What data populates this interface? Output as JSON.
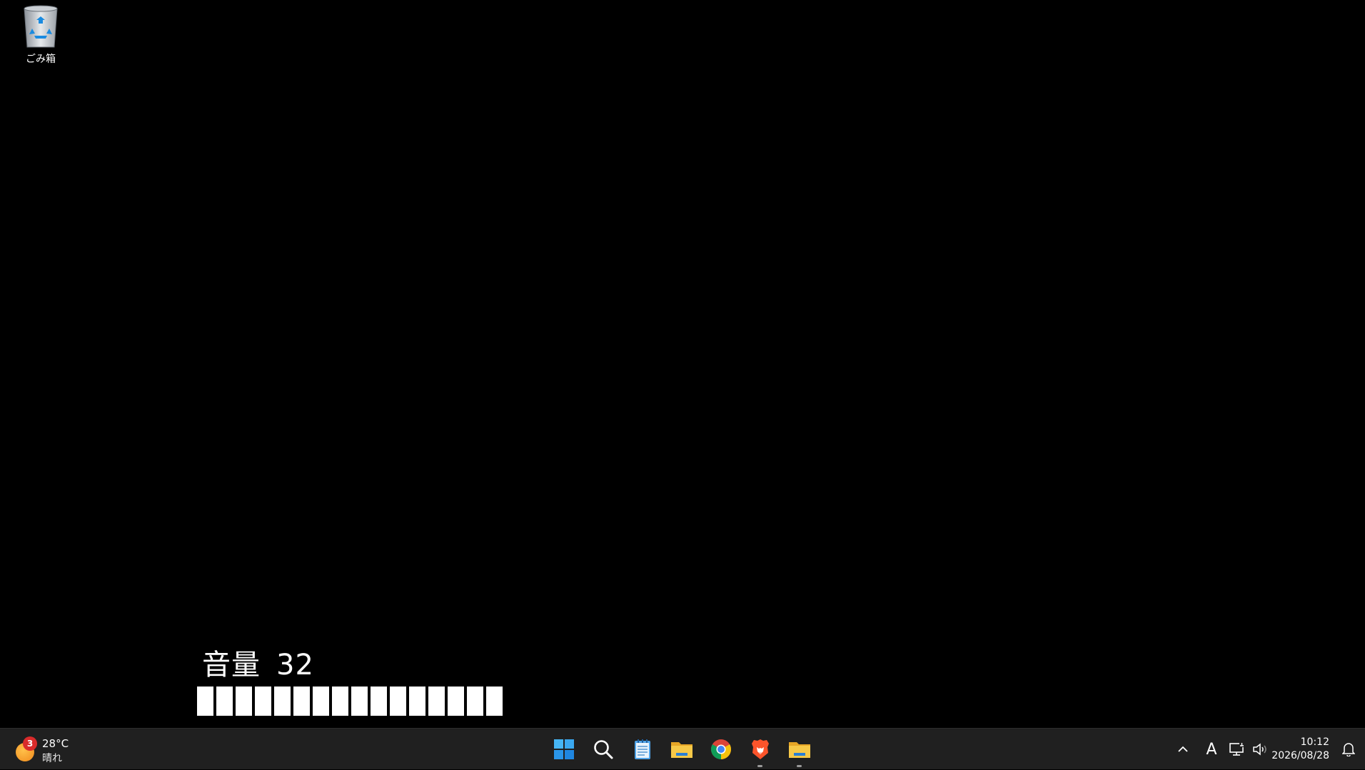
{
  "desktop": {
    "icons": [
      {
        "label": "ごみ箱",
        "icon": "recycle-bin-icon"
      }
    ]
  },
  "volume_osd": {
    "label": "音量",
    "value": "32",
    "level_percent": 32,
    "segments_filled": 16
  },
  "taskbar": {
    "weather": {
      "badge_count": "3",
      "temperature": "28°C",
      "condition": "晴れ",
      "icon": "sun-icon"
    },
    "apps": [
      {
        "name": "start",
        "icon": "windows-logo-icon",
        "running": false
      },
      {
        "name": "search",
        "icon": "search-icon",
        "running": false
      },
      {
        "name": "notepad",
        "icon": "notepad-icon",
        "running": false
      },
      {
        "name": "file-explorer",
        "icon": "folder-icon",
        "running": false
      },
      {
        "name": "chrome",
        "icon": "chrome-icon",
        "running": false
      },
      {
        "name": "brave",
        "icon": "brave-lion-icon",
        "running": true
      },
      {
        "name": "file-explorer-2",
        "icon": "folder-icon",
        "running": true
      }
    ],
    "tray": {
      "overflow_icon": "chevron-up-icon",
      "ime_indicator": "A",
      "network_icon": "network-icon",
      "volume_icon": "speaker-icon",
      "notification_icon": "bell-icon"
    },
    "clock": {
      "time": "10:12",
      "date": "2026/08/28"
    }
  },
  "colors": {
    "desktop_bg": "#000000",
    "taskbar_bg": "#202020",
    "badge": "#d92b2b",
    "windows_blue": "#3aa0f0"
  }
}
